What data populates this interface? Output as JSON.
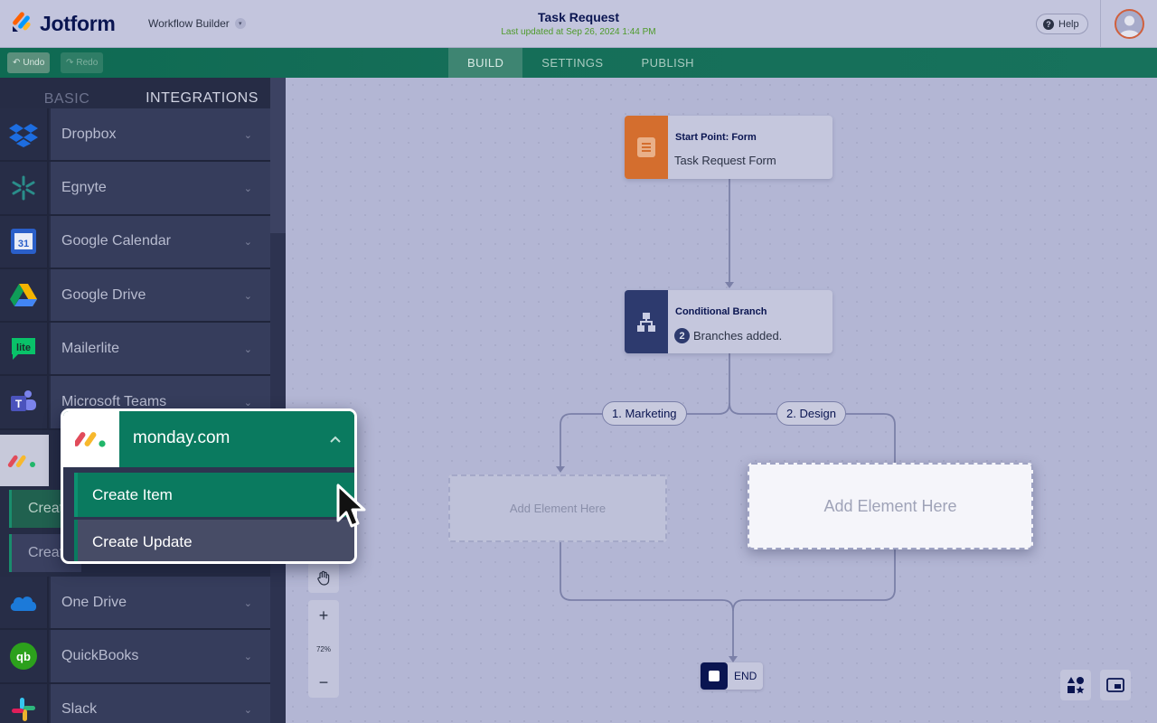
{
  "header": {
    "brand": "Jotform",
    "builder_label": "Workflow Builder",
    "title": "Task Request",
    "last_updated": "Last updated at Sep 26, 2024 1:44 PM",
    "help_label": "Help"
  },
  "toolbar": {
    "undo_label": "Undo",
    "redo_label": "Redo",
    "tabs": [
      {
        "label": "BUILD",
        "active": true
      },
      {
        "label": "SETTINGS",
        "active": false
      },
      {
        "label": "PUBLISH",
        "active": false
      }
    ]
  },
  "sidebar": {
    "tabs": [
      {
        "label": "BASIC",
        "active": false
      },
      {
        "label": "INTEGRATIONS",
        "active": true
      }
    ],
    "integrations_top": [
      {
        "label": "Dropbox",
        "icon": "dropbox-icon"
      },
      {
        "label": "Egnyte",
        "icon": "egnyte-icon"
      },
      {
        "label": "Google Calendar",
        "icon": "google-calendar-icon"
      },
      {
        "label": "Google Drive",
        "icon": "google-drive-icon"
      },
      {
        "label": "Mailerlite",
        "icon": "mailerlite-icon"
      },
      {
        "label": "Microsoft Teams",
        "icon": "microsoft-teams-icon"
      }
    ],
    "integrations_bottom": [
      {
        "label": "One Drive",
        "icon": "onedrive-icon"
      },
      {
        "label": "QuickBooks",
        "icon": "quickbooks-icon"
      },
      {
        "label": "Slack",
        "icon": "slack-icon"
      }
    ],
    "ghost_sub_1": "Create",
    "ghost_sub_2": "Creat"
  },
  "popup": {
    "title": "monday.com",
    "actions": [
      "Create Item",
      "Create Update"
    ]
  },
  "canvas": {
    "start_node": {
      "heading": "Start Point: Form",
      "text": "Task Request Form"
    },
    "branch_node": {
      "heading": "Conditional Branch",
      "count": "2",
      "text": "Branches added."
    },
    "branch_labels": [
      "1. Marketing",
      "2. Design"
    ],
    "drop_zone_label": "Add Element Here",
    "drop_zone_active_label": "Add Element Here",
    "end_label": "END",
    "zoom_level": "72%"
  },
  "colors": {
    "brand_navy": "#0a1551",
    "accent_green": "#0a7a5f",
    "start_orange": "#d46e2e",
    "branch_navy": "#2d3a6e"
  }
}
